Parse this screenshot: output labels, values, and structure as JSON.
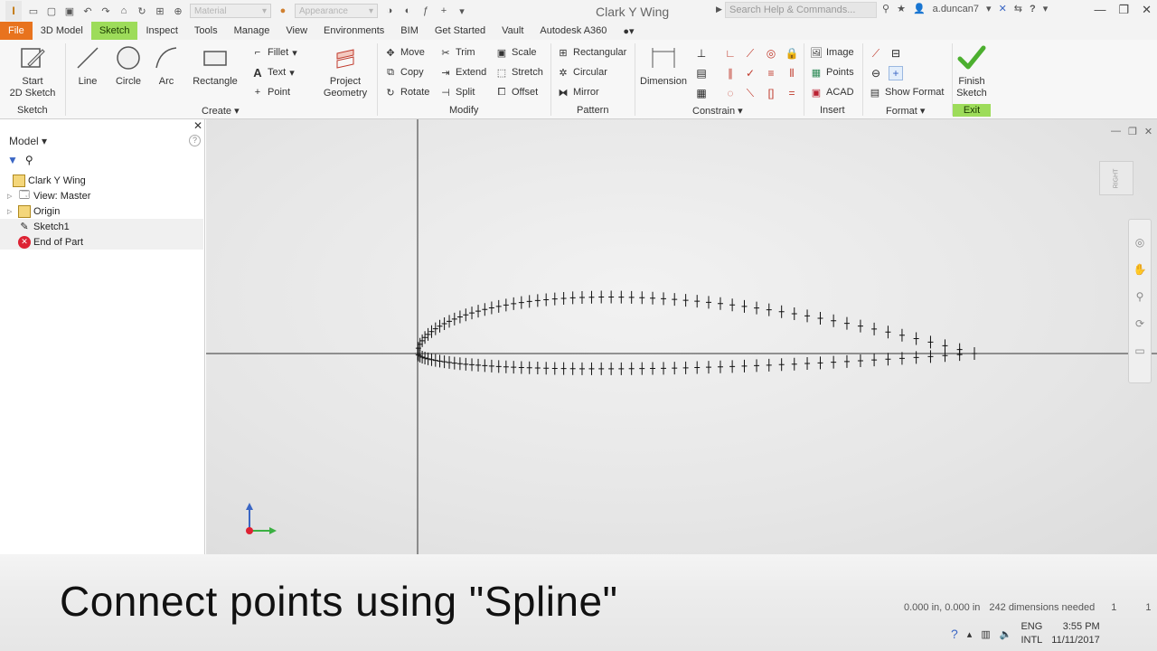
{
  "titlebar": {
    "material_placeholder": "Material",
    "appearance_placeholder": "Appearance",
    "title": "Clark Y Wing",
    "search_placeholder": "Search Help & Commands...",
    "user": "a.duncan7"
  },
  "tabs": [
    "File",
    "3D Model",
    "Sketch",
    "Inspect",
    "Tools",
    "Manage",
    "View",
    "Environments",
    "BIM",
    "Get Started",
    "Vault",
    "Autodesk A360"
  ],
  "ribbon": {
    "sketch_panel": {
      "start_label": "Start\n2D Sketch",
      "title": "Sketch"
    },
    "create_panel": {
      "line": "Line",
      "circle": "Circle",
      "arc": "Arc",
      "rectangle": "Rectangle",
      "fillet": "Fillet",
      "text": "Text",
      "point": "Point",
      "project": "Project\nGeometry",
      "title": "Create"
    },
    "modify_panel": {
      "move": "Move",
      "copy": "Copy",
      "rotate": "Rotate",
      "trim": "Trim",
      "extend": "Extend",
      "split": "Split",
      "scale": "Scale",
      "stretch": "Stretch",
      "offset": "Offset",
      "title": "Modify"
    },
    "pattern_panel": {
      "rectangular": "Rectangular",
      "circular": "Circular",
      "mirror": "Mirror",
      "title": "Pattern"
    },
    "constrain_panel": {
      "dimension": "Dimension",
      "title": "Constrain"
    },
    "insert_panel": {
      "image": "Image",
      "points": "Points",
      "acad": "ACAD",
      "title": "Insert"
    },
    "format_panel": {
      "show_format": "Show Format",
      "title": "Format"
    },
    "exit_panel": {
      "finish": "Finish\nSketch",
      "title": "Exit"
    }
  },
  "browser": {
    "title": "Model",
    "help": "?",
    "items": [
      {
        "label": "Clark Y Wing"
      },
      {
        "label": "View: Master"
      },
      {
        "label": "Origin"
      },
      {
        "label": "Sketch1"
      },
      {
        "label": "End of Part"
      }
    ]
  },
  "viewcube": {
    "face": "RIGHT"
  },
  "caption": "Connect points using \"Spline\"",
  "status": {
    "coords": "0.000 in, 0.000 in",
    "dims_needed": "242 dimensions needed",
    "val1": "1",
    "val2": "1"
  },
  "tray": {
    "lang1": "ENG",
    "lang2": "INTL",
    "time": "3:55 PM",
    "date": "11/11/2017"
  },
  "colors": {
    "file_tab": "#e8731e",
    "sketch_tab": "#9ddc5a",
    "finish_check": "#4caf2f"
  },
  "icons": {
    "finish": "green-checkmark-icon",
    "end_of_part": "red-x-icon"
  }
}
